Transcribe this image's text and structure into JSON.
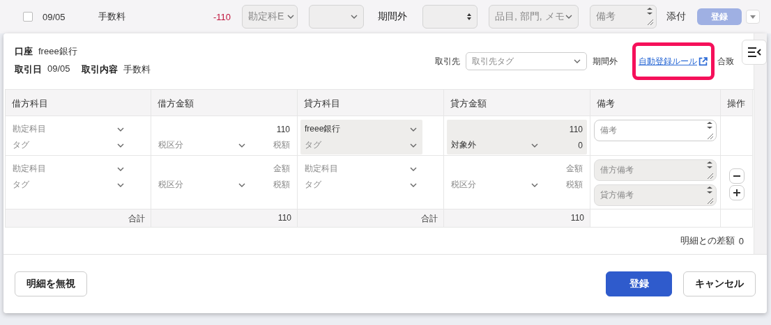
{
  "list_row": {
    "checked": false,
    "date": "09/05",
    "description": "手数料",
    "amount": "-110",
    "account_select": "勘定科E",
    "period": "期間外",
    "items_select": "品目, 部門, メモ",
    "memo_placeholder": "備考",
    "attach": "添付",
    "register_button": {
      "label": "登録",
      "disabled": true
    }
  },
  "detail": {
    "account": {
      "label": "口座",
      "value": "freee銀行"
    },
    "date": {
      "label": "取引日",
      "value": "09/05"
    },
    "content": {
      "label": "取引内容",
      "value": "手数料"
    },
    "partner": {
      "label": "取引先",
      "placeholder": "取引先タグ"
    },
    "period": "期間外",
    "rule_link": "自動登録ルール",
    "match_text": "合致",
    "highlighted": true
  },
  "table": {
    "columns": [
      "借方科目",
      "借方金額",
      "貸方科目",
      "貸方金額",
      "備考",
      "操作"
    ],
    "rows": [
      {
        "debit": {
          "locked": false,
          "account": {
            "placeholder": "勘定科目"
          },
          "tag": {
            "placeholder": "タグ"
          },
          "amount": {
            "value": "110"
          },
          "tax_class": {
            "placeholder": "税区分"
          },
          "tax": {
            "placeholder": "税額"
          }
        },
        "credit": {
          "locked": true,
          "account": {
            "value": "freee銀行"
          },
          "tag": {
            "placeholder": "タグ"
          },
          "amount": {
            "value": "110"
          },
          "tax_class": {
            "value": "対象外"
          },
          "tax": {
            "value": "0"
          }
        },
        "memos": [
          {
            "placeholder": "備考",
            "disabled": false
          }
        ],
        "actions": []
      },
      {
        "debit": {
          "locked": false,
          "account": {
            "placeholder": "勘定科目"
          },
          "tag": {
            "placeholder": "タグ"
          },
          "amount": {
            "placeholder": "金額"
          },
          "tax_class": {
            "placeholder": "税区分"
          },
          "tax": {
            "placeholder": "税額"
          }
        },
        "credit": {
          "locked": false,
          "account": {
            "placeholder": "勘定科目"
          },
          "tag": {
            "placeholder": "タグ"
          },
          "amount": {
            "placeholder": "金額"
          },
          "tax_class": {
            "placeholder": "税区分"
          },
          "tax": {
            "placeholder": "税額"
          }
        },
        "memos": [
          {
            "placeholder": "借方備考",
            "disabled": true
          },
          {
            "placeholder": "貸方備考",
            "disabled": true
          }
        ],
        "actions": [
          {
            "kind": "remove"
          },
          {
            "kind": "add"
          }
        ]
      }
    ],
    "totals": {
      "debit_label": "合計",
      "debit_amount": "110",
      "credit_label": "合計",
      "credit_amount": "110"
    }
  },
  "difference": {
    "label": "明細との差額",
    "value": "0"
  },
  "footer": {
    "ignore_button": "明細を無視",
    "register_button": "登録",
    "cancel_button": "キャンセル"
  }
}
